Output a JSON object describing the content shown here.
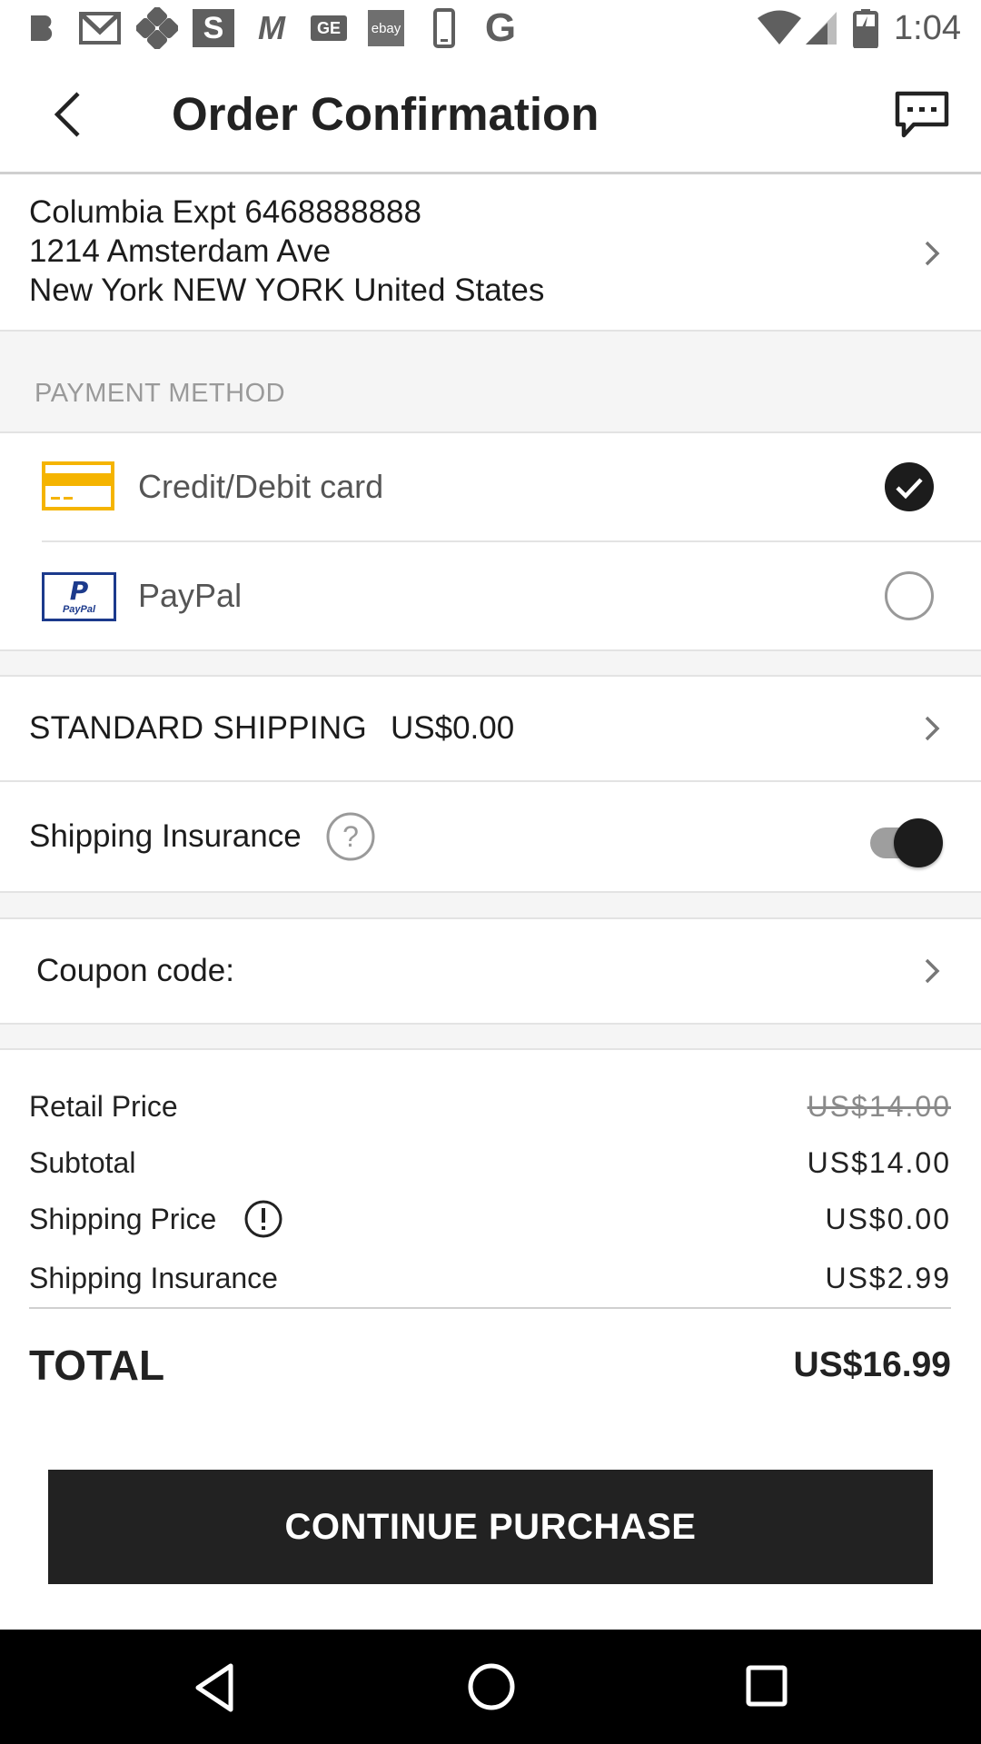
{
  "status_bar": {
    "time": "1:04",
    "notification_icons": [
      "b-app-icon",
      "gmail-icon",
      "grid-app-icon",
      "s-app-icon",
      "m-app-icon",
      "ge-app-icon",
      "ebay-icon",
      "phone-icon",
      "google-icon"
    ],
    "ge_text": "GE",
    "ebay_text": "ebay",
    "s_text": "S",
    "m_text": "M",
    "g_text": "G"
  },
  "header": {
    "title": "Order Confirmation"
  },
  "address": {
    "line1": "Columbia Expt 6468888888",
    "line2": "1214 Amsterdam Ave",
    "line3": "New York NEW YORK United States"
  },
  "payment": {
    "section_title": "PAYMENT METHOD",
    "methods": [
      {
        "label": "Credit/Debit card",
        "selected": true
      },
      {
        "label": "PayPal",
        "selected": false
      }
    ],
    "paypal_logo_text": "PayPal"
  },
  "shipping": {
    "method_label": "STANDARD SHIPPING",
    "method_price": "US$0.00",
    "insurance_label": "Shipping Insurance",
    "insurance_enabled": true
  },
  "coupon": {
    "label": "Coupon code:"
  },
  "summary": {
    "retail_price_label": "Retail Price",
    "retail_price_value": "US$14.00",
    "subtotal_label": "Subtotal",
    "subtotal_value": "US$14.00",
    "shipping_price_label": "Shipping Price",
    "shipping_price_value": "US$0.00",
    "insurance_label": "Shipping Insurance",
    "insurance_value": "US$2.99",
    "total_label": "TOTAL",
    "total_value": "US$16.99"
  },
  "actions": {
    "continue_label": "CONTINUE PURCHASE"
  },
  "colors": {
    "card_icon": "#F5B400",
    "paypal_icon": "#1C3A8C",
    "button_bg": "#222222"
  }
}
